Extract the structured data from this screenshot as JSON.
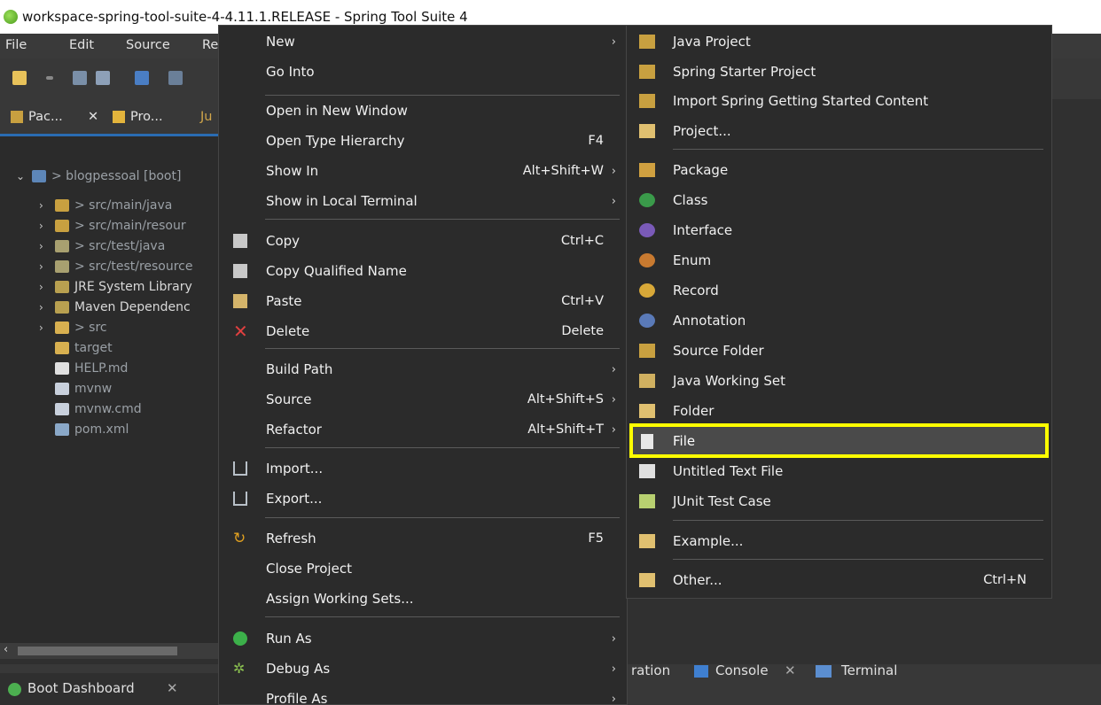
{
  "window": {
    "title": "workspace-spring-tool-suite-4-4.11.1.RELEASE - Spring Tool Suite 4"
  },
  "menubar": {
    "file": "File",
    "edit": "Edit",
    "source": "Source",
    "refactor_partial": "Re"
  },
  "view_tabs": {
    "package_explorer": "Pac...",
    "project_explorer": "Pro...",
    "junit_partial": "Ju"
  },
  "tree": {
    "project": "> blogpessoal [boot]",
    "items": [
      {
        "label": "> src/main/java"
      },
      {
        "label": "> src/main/resour"
      },
      {
        "label": "> src/test/java"
      },
      {
        "label": "> src/test/resource"
      },
      {
        "label": "JRE System Library"
      },
      {
        "label": "Maven Dependenc"
      },
      {
        "label": "> src"
      },
      {
        "label": "target"
      },
      {
        "label": "HELP.md"
      },
      {
        "label": "mvnw"
      },
      {
        "label": "mvnw.cmd"
      },
      {
        "label": "pom.xml"
      }
    ]
  },
  "context_menu": {
    "new": "New",
    "go_into": "Go Into",
    "open_new_window": "Open in New Window",
    "open_type_hierarchy": "Open Type Hierarchy",
    "open_type_hierarchy_acc": "F4",
    "show_in": "Show In",
    "show_in_acc": "Alt+Shift+W",
    "show_local_terminal": "Show in Local Terminal",
    "copy": "Copy",
    "copy_acc": "Ctrl+C",
    "copy_qualified": "Copy Qualified Name",
    "paste": "Paste",
    "paste_acc": "Ctrl+V",
    "delete": "Delete",
    "delete_acc": "Delete",
    "build_path": "Build Path",
    "source": "Source",
    "source_acc": "Alt+Shift+S",
    "refactor": "Refactor",
    "refactor_acc": "Alt+Shift+T",
    "import": "Import...",
    "export": "Export...",
    "refresh": "Refresh",
    "refresh_acc": "F5",
    "close_project": "Close Project",
    "assign_working_sets": "Assign Working Sets...",
    "run_as": "Run As",
    "debug_as": "Debug As",
    "profile_as": "Profile As"
  },
  "submenu": {
    "java_project": "Java Project",
    "spring_starter": "Spring Starter Project",
    "import_spring": "Import Spring Getting Started Content",
    "project": "Project...",
    "package": "Package",
    "class": "Class",
    "interface": "Interface",
    "enum": "Enum",
    "record": "Record",
    "annotation": "Annotation",
    "source_folder": "Source Folder",
    "java_working_set": "Java Working Set",
    "folder": "Folder",
    "file": "File",
    "untitled_text_file": "Untitled Text File",
    "junit_test_case": "JUnit Test Case",
    "example": "Example...",
    "other": "Other...",
    "other_acc": "Ctrl+N"
  },
  "bottom": {
    "boot_dashboard": "Boot Dashboard",
    "ration_partial": "ration",
    "console": "Console",
    "terminal": "Terminal"
  },
  "colors": {
    "highlight_border": "#ffff00",
    "accent_blue": "#2a6cb2"
  }
}
